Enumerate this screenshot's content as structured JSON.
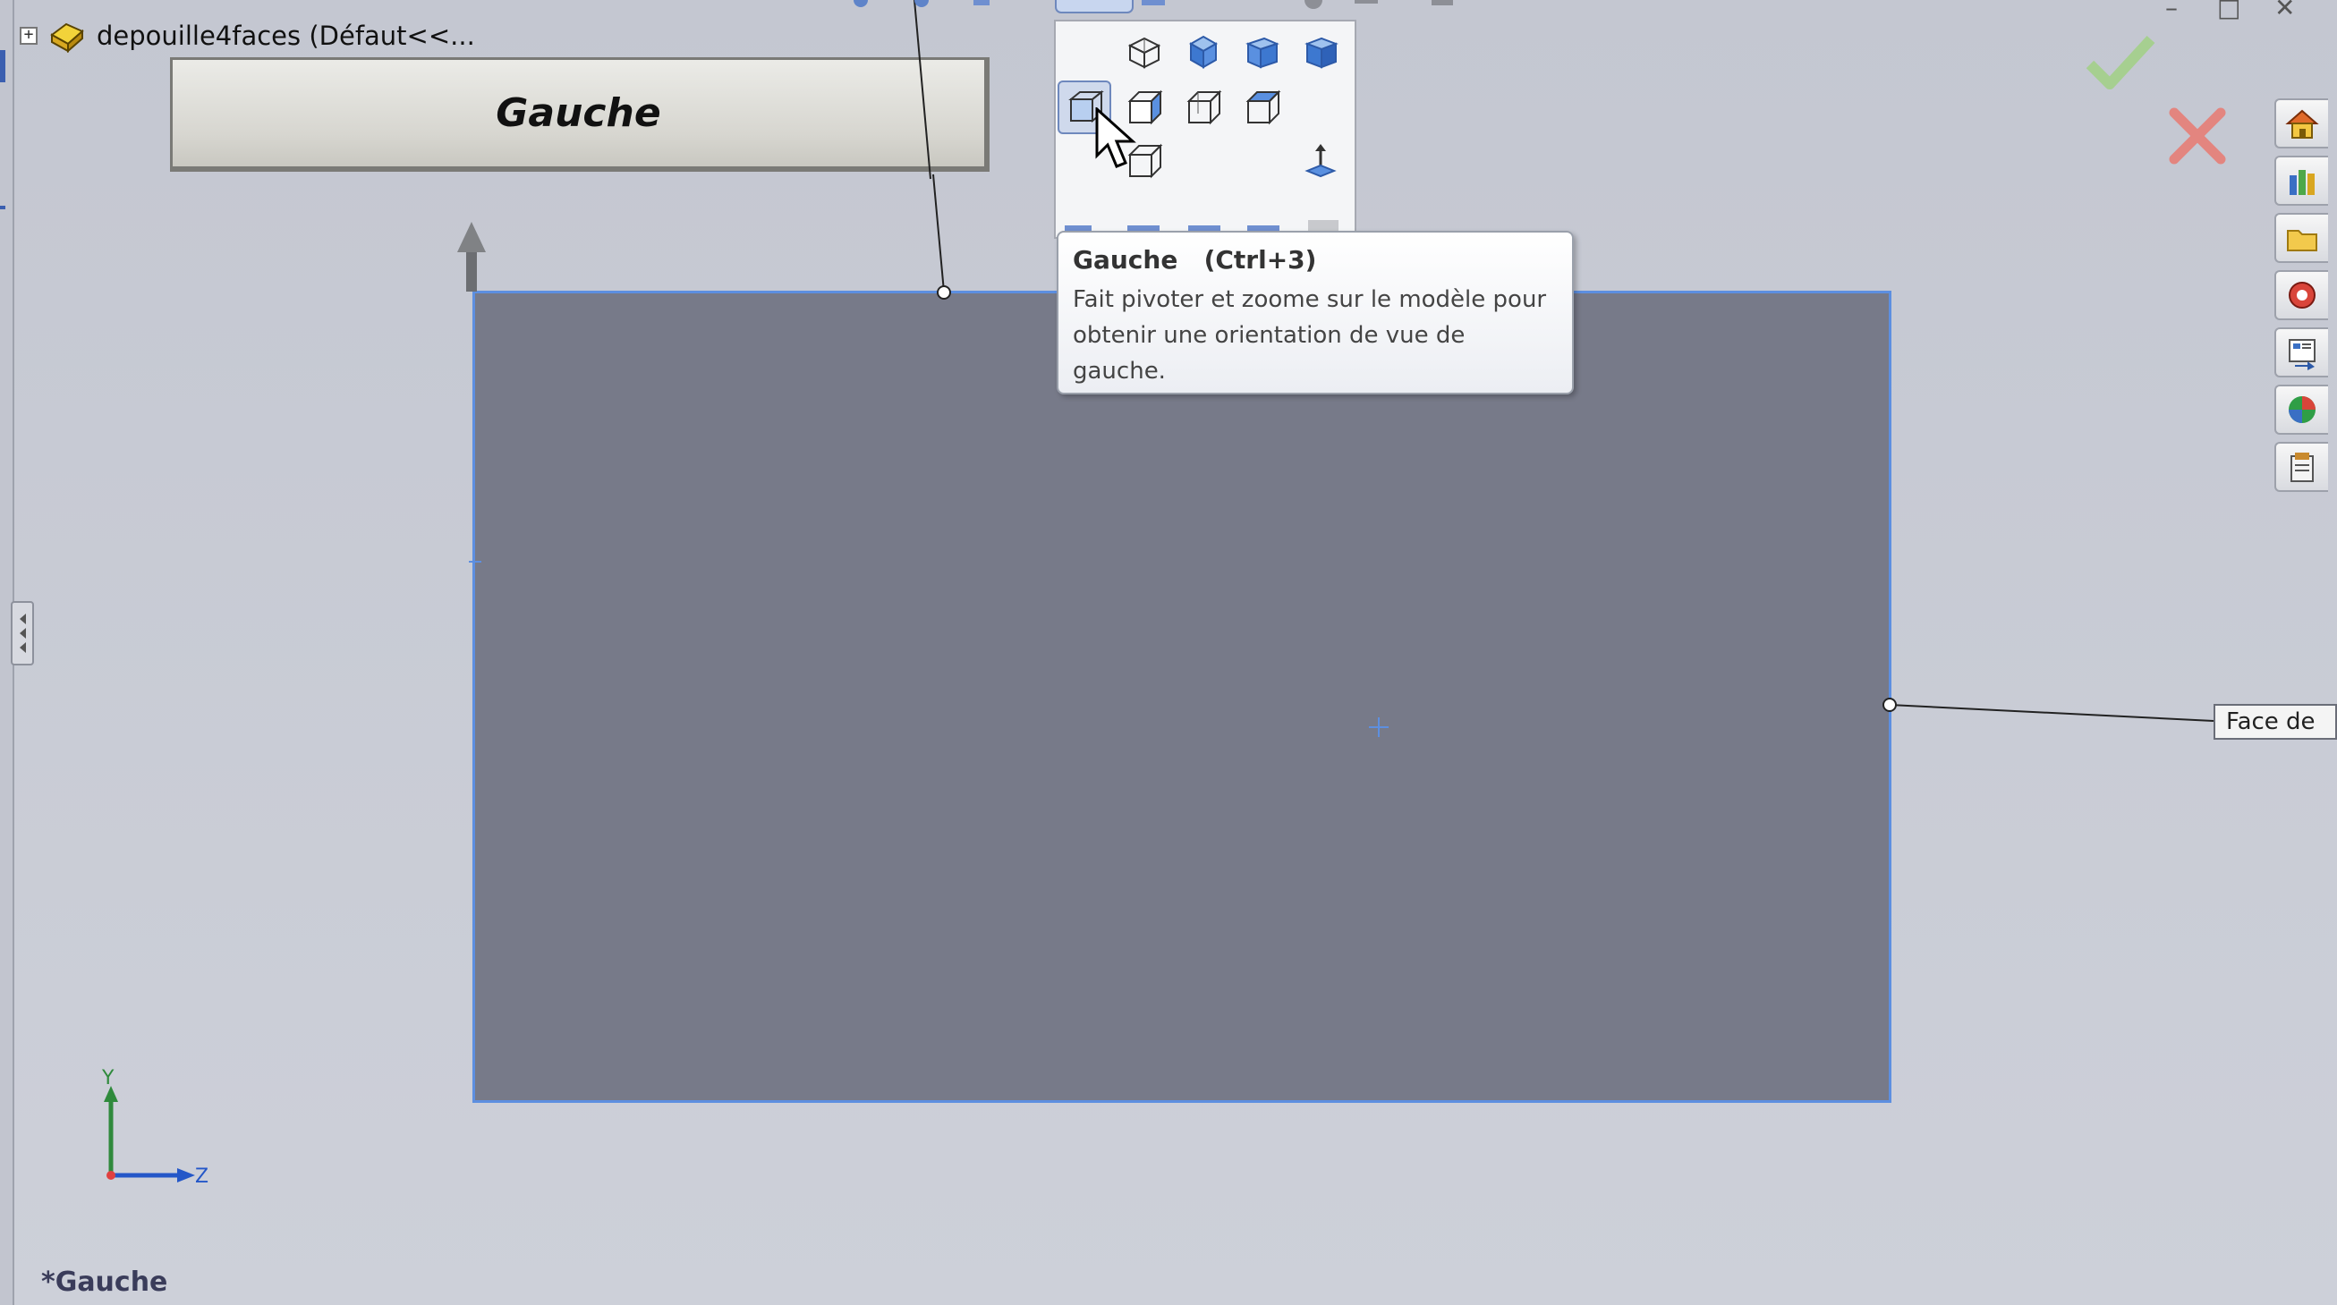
{
  "tree": {
    "expander": "+",
    "part_label": "depouille4faces  (Défaut<<..."
  },
  "banner": {
    "view_name": "Gauche"
  },
  "tooltip": {
    "title": "Gauche   (Ctrl+3)",
    "body": "Fait pivoter et zoome sur le modèle pour obtenir une orientation de vue de gauche."
  },
  "face_label": "Face de",
  "triad": {
    "y_label": "Y",
    "z_label": "Z"
  },
  "status": {
    "view_title": "*Gauche"
  },
  "colors": {
    "background": "#c9ccd6",
    "plane": "#777a89",
    "plane_edge": "#5d8fe0",
    "confirm": "#8fbf7a",
    "cancel": "#e07a74"
  },
  "view_orientation_buttons": [
    "isometric",
    "trimetric",
    "dimetric",
    "normal-to",
    "left",
    "right",
    "top",
    "bottom",
    "back",
    "view-selector"
  ]
}
